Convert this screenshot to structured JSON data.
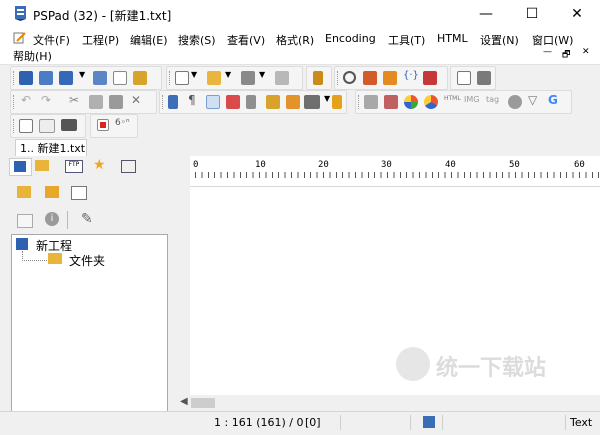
{
  "window": {
    "title": "PSPad (32) - [新建1.txt]",
    "minimize_glyph": "—",
    "maximize_glyph": "☐",
    "close_glyph": "✕"
  },
  "menu": {
    "items": [
      "文件(F)",
      "工程(P)",
      "编辑(E)",
      "搜索(S)",
      "查看(V)",
      "格式(R)",
      "Encoding",
      "工具(T)",
      "HTML",
      "设置(N)",
      "窗口(W)"
    ],
    "help": "帮助(H)",
    "mdi_controls": [
      "—",
      "🗗",
      "✕"
    ]
  },
  "document_tab": {
    "label": "1.. 新建1.txt"
  },
  "project_tree": {
    "root": "新工程",
    "folder": "文件夹"
  },
  "ruler": {
    "marks": [
      "0",
      "10",
      "20",
      "30",
      "40",
      "50",
      "60"
    ]
  },
  "status": {
    "position": "1 : 161 (161) / 0",
    "bracket": "[0]",
    "mode": "Text"
  },
  "watermark": {
    "text": "统一下载站"
  },
  "colors": {
    "accent": "#1e5aa8",
    "folder": "#e8b43a",
    "toolbar_bg": "#f5f5f5"
  }
}
